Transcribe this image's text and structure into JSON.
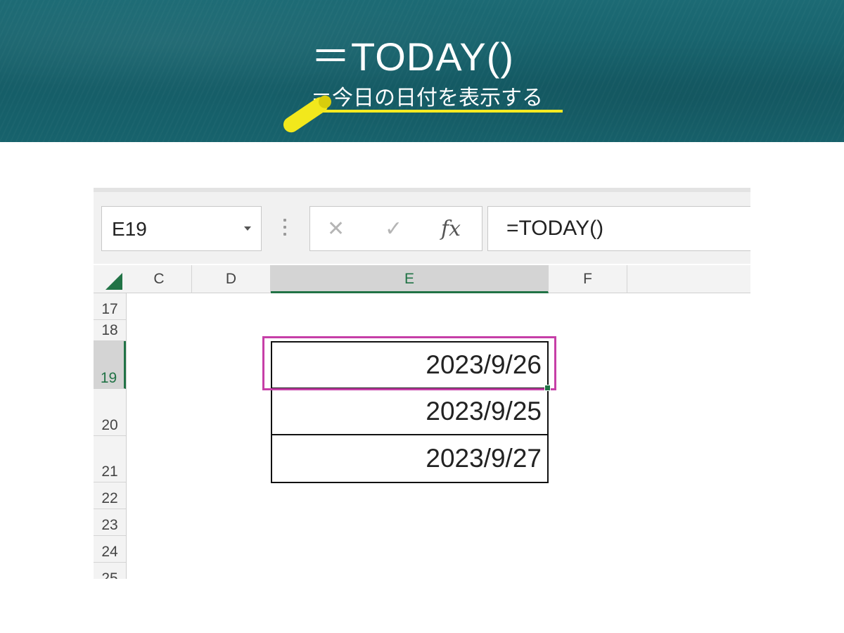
{
  "banner": {
    "title": "＝TODAY()",
    "subtitle": "＝今日の日付を表示する",
    "accent_color": "#f4ea22",
    "background_color": "#17626c"
  },
  "formula_bar": {
    "name_box": "E19",
    "cancel_icon": "✕",
    "enter_icon": "✓",
    "function_icon": "fx",
    "formula": "=TODAY()"
  },
  "columns": [
    "C",
    "D",
    "E",
    "F"
  ],
  "active_column": "E",
  "rows": [
    "17",
    "18",
    "19",
    "20",
    "21",
    "22",
    "23",
    "24",
    "25"
  ],
  "active_row": "19",
  "cells": {
    "e19": "2023/9/26",
    "e20": "2023/9/25",
    "e21": "2023/9/27"
  },
  "colors": {
    "excel_green": "#217346",
    "selection_highlight": "#c63fa7"
  }
}
